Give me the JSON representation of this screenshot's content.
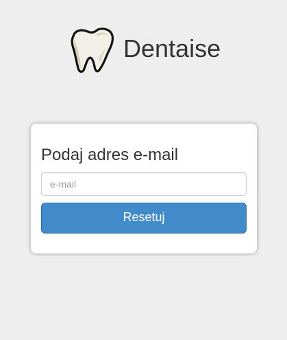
{
  "brand": {
    "name": "Dentaise",
    "logo_icon": "tooth-icon"
  },
  "reset_form": {
    "title": "Podaj adres e-mail",
    "email_placeholder": "e-mail",
    "email_value": "",
    "submit_label": "Resetuj"
  },
  "colors": {
    "page_background": "#eeeeee",
    "card_background": "#ffffff",
    "button_primary": "#428bca",
    "button_border": "#2e6da4",
    "text": "#333333"
  }
}
